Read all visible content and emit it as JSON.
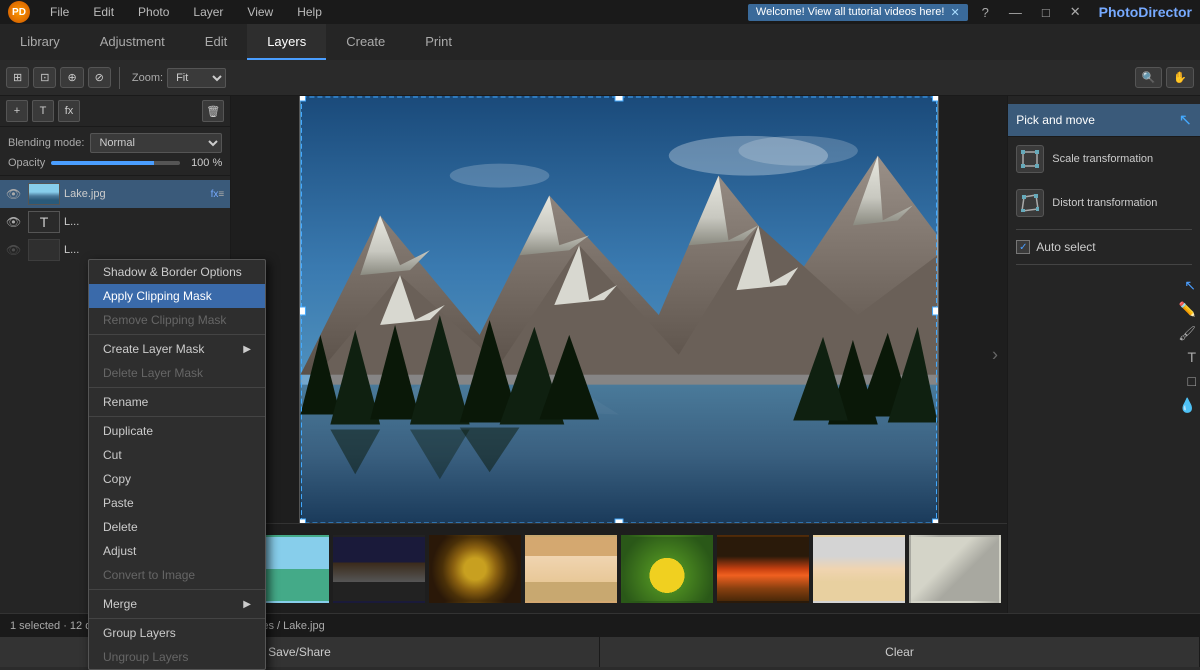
{
  "app": {
    "name": "PhotoDirector",
    "logo": "PD"
  },
  "topbar": {
    "menus": [
      "File",
      "Edit",
      "Photo",
      "Layer",
      "View",
      "Help"
    ],
    "notification": "Welcome! View all tutorial videos here!",
    "win_btns": [
      "?",
      "—",
      "□",
      "✕"
    ]
  },
  "tabs": {
    "items": [
      "Library",
      "Adjustment",
      "Edit",
      "Layers",
      "Create",
      "Print"
    ],
    "active": "Layers"
  },
  "toolbar": {
    "zoom_label": "Zoom:",
    "zoom_value": "Fit",
    "tools": [
      "⊞",
      "⊡",
      "⊕",
      "⊘"
    ]
  },
  "left_panel": {
    "blend_label": "Blending mode:",
    "blend_value": "Normal",
    "opacity_label": "Opacity",
    "opacity_value": "100 %",
    "layers": [
      {
        "name": "Lake.jpg",
        "type": "image",
        "visible": true,
        "fx": true,
        "active": true
      },
      {
        "name": "L...",
        "type": "text",
        "visible": true,
        "fx": false,
        "active": false
      },
      {
        "name": "L...",
        "type": "image",
        "visible": false,
        "fx": false,
        "active": false
      }
    ]
  },
  "context_menu": {
    "items": [
      {
        "label": "Shadow & Border Options",
        "disabled": false,
        "has_sub": false
      },
      {
        "label": "Apply Clipping Mask",
        "disabled": false,
        "has_sub": false,
        "active": true
      },
      {
        "label": "Remove Clipping Mask",
        "disabled": true,
        "has_sub": false
      },
      {
        "label": "separator"
      },
      {
        "label": "Create Layer Mask",
        "disabled": false,
        "has_sub": true
      },
      {
        "label": "Delete Layer Mask",
        "disabled": true,
        "has_sub": false
      },
      {
        "label": "separator"
      },
      {
        "label": "Rename",
        "disabled": false,
        "has_sub": false
      },
      {
        "label": "separator"
      },
      {
        "label": "Duplicate",
        "disabled": false,
        "has_sub": false
      },
      {
        "label": "Cut",
        "disabled": false,
        "has_sub": false
      },
      {
        "label": "Copy",
        "disabled": false,
        "has_sub": false
      },
      {
        "label": "Paste",
        "disabled": false,
        "has_sub": false
      },
      {
        "label": "Delete",
        "disabled": false,
        "has_sub": false
      },
      {
        "label": "Adjust",
        "disabled": false,
        "has_sub": false
      },
      {
        "label": "Convert to Image",
        "disabled": true,
        "has_sub": false
      },
      {
        "label": "separator"
      },
      {
        "label": "Merge",
        "disabled": false,
        "has_sub": true
      },
      {
        "label": "separator"
      },
      {
        "label": "Group Layers",
        "disabled": false,
        "has_sub": false
      },
      {
        "label": "Ungroup Layers",
        "disabled": true,
        "has_sub": false
      }
    ]
  },
  "right_panel": {
    "title": "Pick and move",
    "tools": [
      {
        "label": "Scale transformation",
        "icon": "⊡"
      },
      {
        "label": "Distort transformation",
        "icon": "⊘"
      }
    ],
    "auto_select": "Auto select"
  },
  "filmstrip": {
    "items": [
      {
        "class": "ft-bike",
        "selected": false
      },
      {
        "class": "ft-night",
        "selected": false
      },
      {
        "class": "ft-spiral",
        "selected": false
      },
      {
        "class": "ft-person",
        "selected": false
      },
      {
        "class": "ft-flower",
        "selected": false
      },
      {
        "class": "ft-sunset",
        "selected": false
      },
      {
        "class": "ft-blonde",
        "selected": false
      },
      {
        "class": "ft-partial",
        "selected": false
      }
    ]
  },
  "status_bar": {
    "selection_info": "1 selected · 12 displayed",
    "path": "Folders / Sample Images / Lake.jpg"
  },
  "bottom_bar": {
    "save_label": "Save/Share",
    "clear_label": "Clear"
  }
}
